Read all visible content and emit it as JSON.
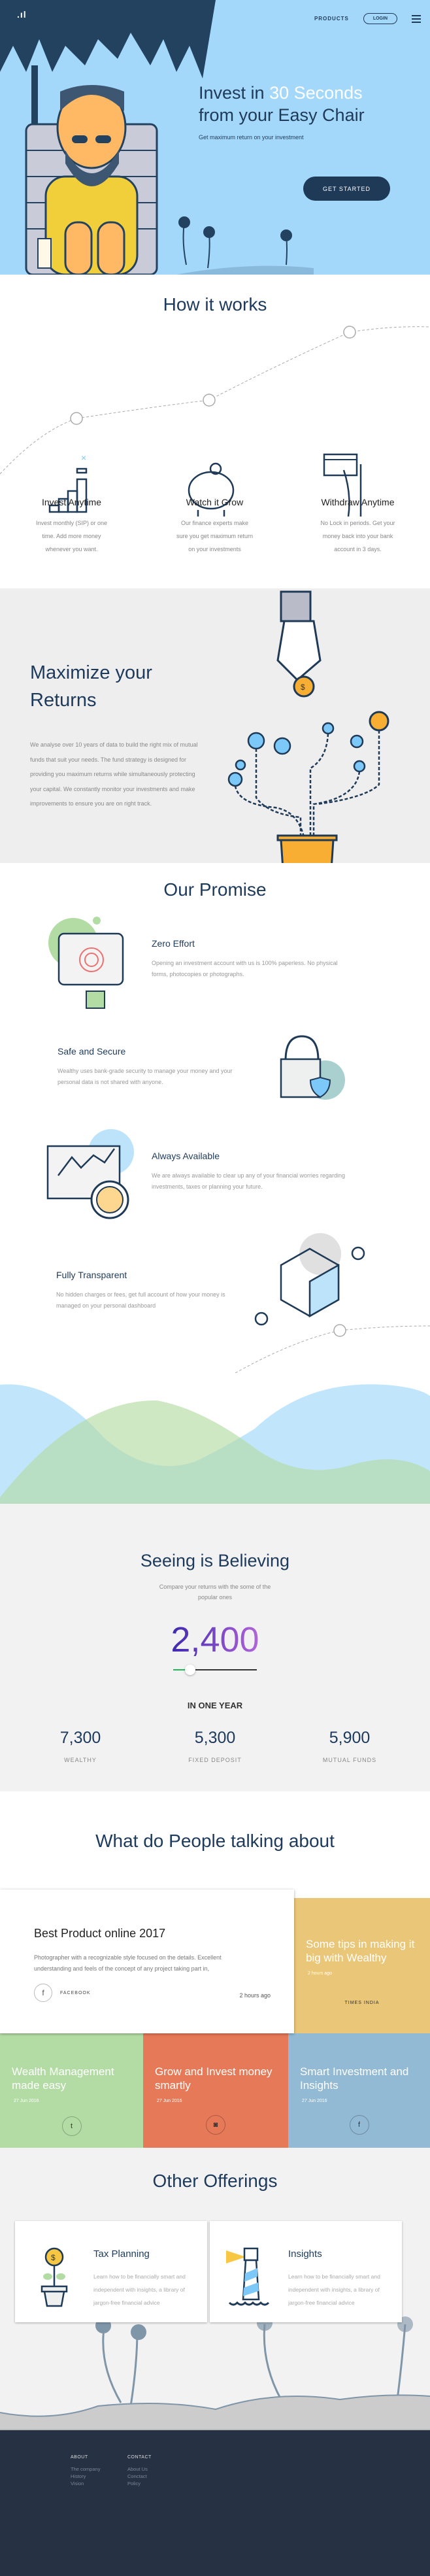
{
  "header": {
    "logo": ".ıl",
    "nav_products": "PRODUCTS",
    "nav_login": "LOGIN",
    "menu_icon": "hamburger-icon"
  },
  "hero": {
    "title_part1": "Invest in ",
    "title_highlight": "30 Seconds",
    "title_part2": "from your Easy Chair",
    "subtitle": "Get maximum return on your investment",
    "cta_label": "GET STARTED"
  },
  "how": {
    "title": "How it works",
    "steps": [
      {
        "icon": "coin-stack-icon",
        "title": "Invest Anytime",
        "text": "Invest monthly (SIP) or one time. Add more money whenever you want."
      },
      {
        "icon": "piggy-bank-icon",
        "title": "Watch it Grow",
        "text": "Our finance experts make sure you get maximum return on your investments"
      },
      {
        "icon": "card-hand-icon",
        "title": "Withdraw Anytime",
        "text": "No Lock in periods. Get your money back into your bank account in 3 days."
      }
    ]
  },
  "maximize": {
    "title": "Maximize your Returns",
    "body": "We analyse over 10 years of data to build the right mix of mutual funds that suit your needs. The fund strategy is designed for providing you maximum returns while simultaneously protecting your capital. We constantly monitor your investments and make improvements to ensure you are on right track."
  },
  "promise": {
    "title": "Our Promise",
    "items": [
      {
        "icon": "tablet-fingerprint-icon",
        "title": "Zero Effort",
        "text": "Opening an investment account with us is 100% paperless. No physical forms, photocopies or photographs."
      },
      {
        "icon": "padlock-shield-icon",
        "title": "Safe and Secure",
        "text": "Wealthy uses bank-grade security to manage your money and your personal data is not shared with anyone."
      },
      {
        "icon": "monitor-stopwatch-icon",
        "title": "Always Available",
        "text": "We are always available to clear up any of your financial worries regarding investments, taxes or planning your future."
      },
      {
        "icon": "cube-icon",
        "title": "Fully Transparent",
        "text": "No hidden charges or fees, get full account of how your money is managed on your personal dashboard"
      }
    ]
  },
  "believing": {
    "title": "Seeing is Believing",
    "subtitle": "Compare your returns with the some of the popular ones",
    "amount": "2,400",
    "slider_fraction": 0.2,
    "period": "IN ONE YEAR",
    "results": [
      {
        "value": "7,300",
        "label": "WEALTHY"
      },
      {
        "value": "5,300",
        "label": "FIXED DEPOSIT"
      },
      {
        "value": "5,900",
        "label": "MUTUAL FUNDS"
      }
    ]
  },
  "talk": {
    "title": "What do People talking about",
    "featured": {
      "title": "Best Product online 2017",
      "text": "Photographer with a recognizable style focused  on the details. Excellent understanding and feels of the concept of any project taking part in,",
      "source": "FACEBOOK",
      "source_icon": "f",
      "time": "2 hours ago"
    },
    "side": {
      "title": "Some tips in making it big with Wealthy",
      "time": "2 hours ago",
      "source": "TIMES INDIA",
      "color": "#eac678"
    },
    "tiles": [
      {
        "title": "Wealth Management made easy",
        "date": "27 Jun 2016",
        "icon": "twitter-icon",
        "glyph": "t",
        "color": "#b3dca4"
      },
      {
        "title": "Grow and Invest money smartly",
        "date": "27 Jun 2016",
        "icon": "instagram-icon",
        "glyph": "◙",
        "color": "#e67957"
      },
      {
        "title": "Smart Investment and Insights",
        "date": "27 Jun 2016",
        "icon": "facebook-icon",
        "glyph": "f",
        "color": "#93bad4"
      }
    ]
  },
  "offerings": {
    "title": "Other Offerings",
    "items": [
      {
        "icon": "money-plant-icon",
        "title": "Tax Planning",
        "text": "Learn how to be financially smart and independent with insights, a library of jargon-free financial advice"
      },
      {
        "icon": "lighthouse-icon",
        "title": "Insights",
        "text": "Learn how to be financially smart and independent with insights, a library of jargon-free financial advice"
      }
    ]
  },
  "footer": {
    "about_heading": "ABOUT",
    "about_links": [
      "The company",
      "History",
      "Vision"
    ],
    "contact_heading": "CONTACT",
    "contact_links": [
      "About Us",
      "Conctact",
      "Policy"
    ]
  },
  "colors": {
    "navy": "#1f3a57",
    "hero_bg": "#a3d8fb",
    "light_blue": "#7cc8f8",
    "orange": "#f7ae33",
    "footer_bg": "#263144"
  }
}
